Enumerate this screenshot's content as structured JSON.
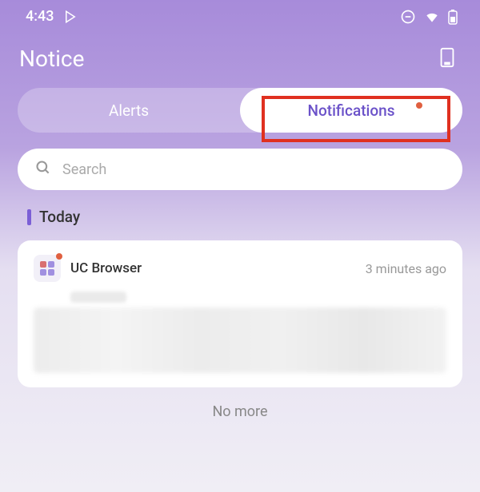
{
  "status_bar": {
    "time": "4:43"
  },
  "header": {
    "title": "Notice"
  },
  "tabs": {
    "alerts": "Alerts",
    "notifications": "Notifications"
  },
  "search": {
    "placeholder": "Search"
  },
  "section": {
    "today": "Today"
  },
  "card": {
    "app_name": "UC Browser",
    "time": "3 minutes ago"
  },
  "footer": {
    "no_more": "No more"
  }
}
